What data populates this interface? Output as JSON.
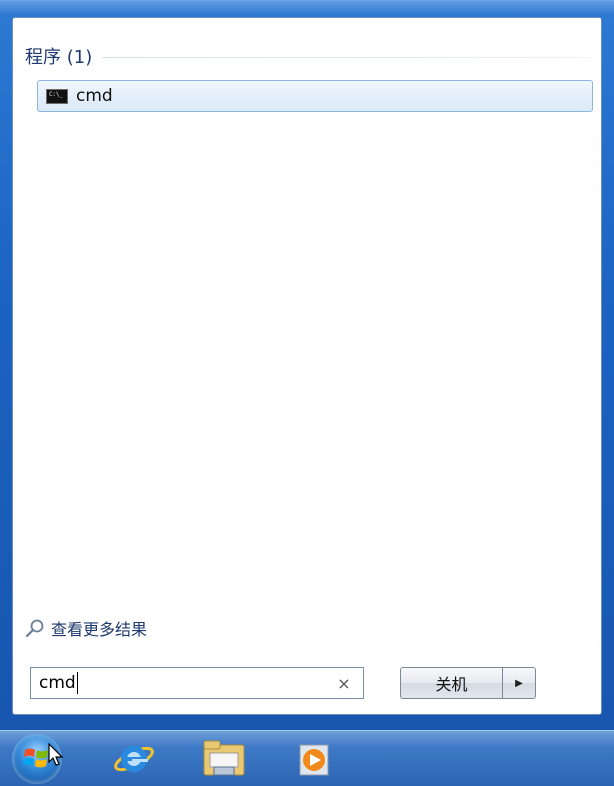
{
  "start_menu": {
    "group": {
      "title": "程序 (1)"
    },
    "results": [
      {
        "icon": "command-prompt-icon",
        "label": "cmd"
      }
    ],
    "see_more": {
      "icon": "search-icon",
      "label": "查看更多结果"
    },
    "search": {
      "value": "cmd",
      "clear_icon": "close-icon",
      "clear_glyph": "×"
    },
    "shutdown": {
      "label": "关机",
      "arrow_glyph": "▶"
    }
  },
  "taskbar": {
    "items": [
      {
        "icon": "windows-start-orb-icon"
      },
      {
        "icon": "internet-explorer-icon"
      },
      {
        "icon": "windows-explorer-icon"
      },
      {
        "icon": "media-player-icon"
      }
    ]
  },
  "colors": {
    "frame_blue": "#1c63c2",
    "header_text": "#1e3a6e",
    "selection_border": "#8eb4e0"
  }
}
